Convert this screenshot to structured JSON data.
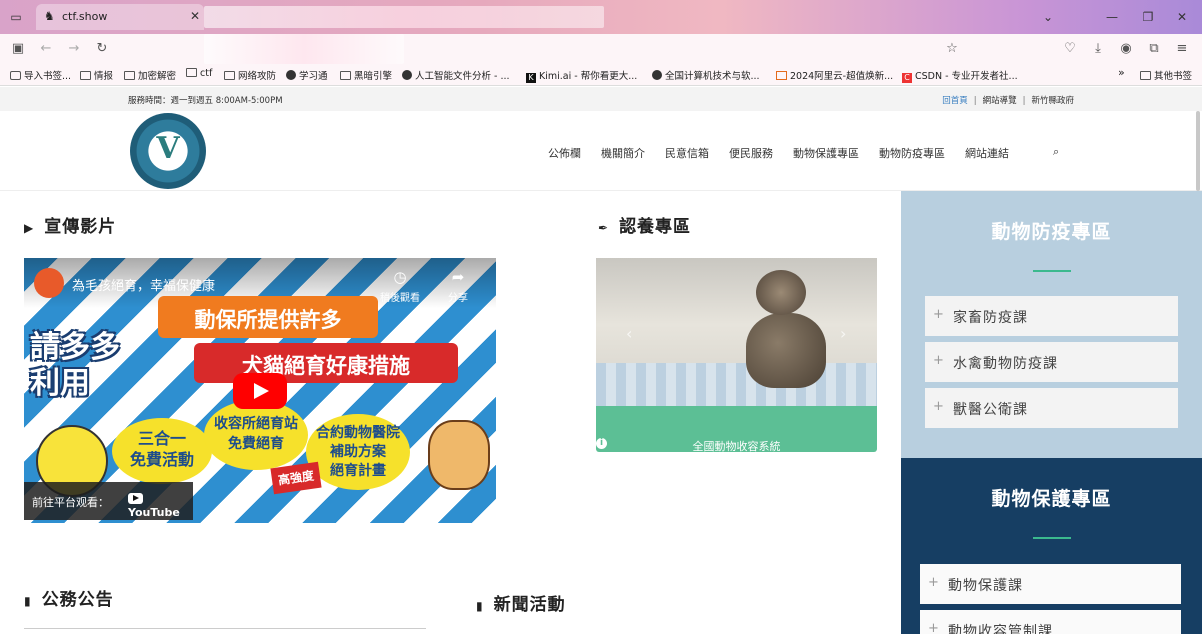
{
  "browser": {
    "tab_title": "ctf.show",
    "bookmarks": [
      {
        "icon": "import-icon",
        "label": "导入书签..."
      },
      {
        "icon": "folder-icon",
        "label": "情报"
      },
      {
        "icon": "folder-icon",
        "label": "加密解密"
      },
      {
        "icon": "folder-icon",
        "label": "ctf"
      },
      {
        "icon": "folder-icon",
        "label": "网络攻防"
      },
      {
        "icon": "globe-icon",
        "label": "学习通"
      },
      {
        "icon": "folder-icon",
        "label": "黑暗引擎"
      },
      {
        "icon": "doc-ai-icon",
        "label": "人工智能文件分析 - ..."
      },
      {
        "icon": "kimi-icon",
        "label": "Kimi.ai - 帮你看更大..."
      },
      {
        "icon": "globe-icon",
        "label": "全国计算机技术与软..."
      },
      {
        "icon": "aliyun-icon",
        "label": "2024阿里云-超值焕新..."
      },
      {
        "icon": "csdn-icon",
        "label": "CSDN - 专业开发者社..."
      }
    ],
    "other_bookmarks": "其他书签"
  },
  "site": {
    "hours": "服務時間：週一到週五 8:00AM-5:00PM",
    "toplinks": {
      "home": "回首頁",
      "guide": "網站導覽",
      "gov": "新竹縣政府"
    },
    "menu": [
      "公佈欄",
      "機關簡介",
      "民意信箱",
      "便民服務",
      "動物保護專區",
      "動物防疫專區",
      "網站連結"
    ],
    "sections": {
      "video": "宣傳影片",
      "adopt": "認養專區",
      "notices": "公務公告",
      "news": "新聞活動"
    },
    "video": {
      "title": "為毛孩絕育，幸福保健康",
      "watch_later": "稍後觀看",
      "share": "分享",
      "watch_on": "前往平台观看：",
      "youtube": "YouTube",
      "banner_orange": "動保所提供許多",
      "banner_red": "犬貓絕育好康措施",
      "big_text_1": "請多多",
      "big_text_2": "利用",
      "bubble_1": "三合一\n免費活動",
      "bubble_2": "收容所絕育站\n免費絕育",
      "bubble_3": "合約動物醫院\n補助方案\n絕育計畫",
      "badge": "高強度"
    },
    "adopt_button": "全國動物收容系統",
    "sidebar": {
      "epidemic_title": "動物防疫專區",
      "epidemic_items": [
        "家畜防疫課",
        "水禽動物防疫課",
        "獸醫公衛課"
      ],
      "protect_title": "動物保護專區",
      "protect_items": [
        "動物保護課",
        "動物收容管制課"
      ]
    }
  },
  "colors": {
    "sidebar_light": "#b8cfdf",
    "sidebar_dark": "#163e63",
    "accent_green": "#5cbf95",
    "divider_green": "#3bb98e"
  }
}
